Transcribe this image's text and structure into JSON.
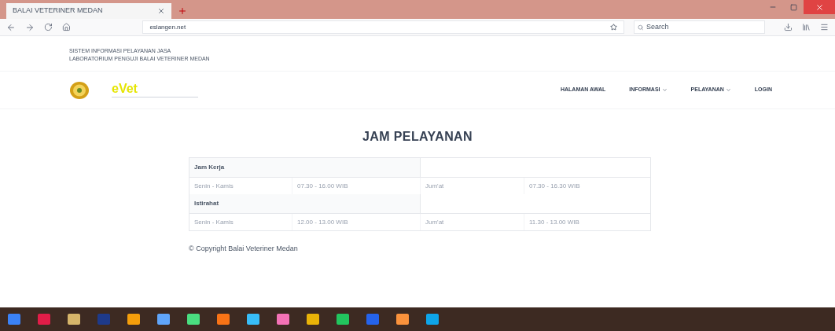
{
  "browser": {
    "tab_title": "BALAI VETERINER MEDAN",
    "url": "eslangen.net",
    "search_placeholder": "Search"
  },
  "site_header": [
    "SISTEM INFORMASI PELAYANAN JASA",
    "LABORATORIUM PENGUJI BALAI VETERINER MEDAN"
  ],
  "logo_text": "eVet",
  "nav": [
    {
      "label": "HALAMAN AWAL",
      "dropdown": false
    },
    {
      "label": "INFORMASI",
      "dropdown": true
    },
    {
      "label": "PELAYANAN",
      "dropdown": true
    },
    {
      "label": "LOGIN",
      "dropdown": false
    }
  ],
  "page_title": "JAM PELAYANAN",
  "table": {
    "sections": [
      {
        "heading": "Jam Kerja",
        "row": [
          "Senin - Kamis",
          "07.30 - 16.00 WIB",
          "Jum'at",
          "07.30 - 16.30 WIB"
        ]
      },
      {
        "heading": "Istirahat",
        "row": [
          "Senin - Kamis",
          "12.00 - 13.00 WIB",
          "Jum'at",
          "11.30 - 13.00 WIB"
        ]
      }
    ]
  },
  "footer": "© Copyright Balai Veteriner Medan"
}
